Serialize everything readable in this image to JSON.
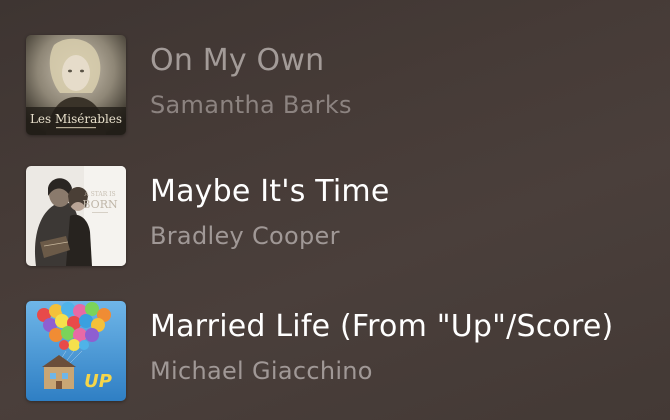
{
  "tracks": [
    {
      "title": "On My Own",
      "artist": "Samantha Barks",
      "artwork": "les-miserables-album-art",
      "artwork_text": "Les Misérables"
    },
    {
      "title": "Maybe It's Time",
      "artist": "Bradley Cooper",
      "artwork": "a-star-is-born-album-art"
    },
    {
      "title": "Married Life (From \"Up\"/Score)",
      "artist": "Michael Giacchino",
      "artwork": "up-album-art",
      "artwork_text": "UP"
    }
  ],
  "colors": {
    "background": "#463b37",
    "title_active": "#ffffff",
    "title_dimmed": "#a39b98",
    "artist": "#a09896"
  }
}
